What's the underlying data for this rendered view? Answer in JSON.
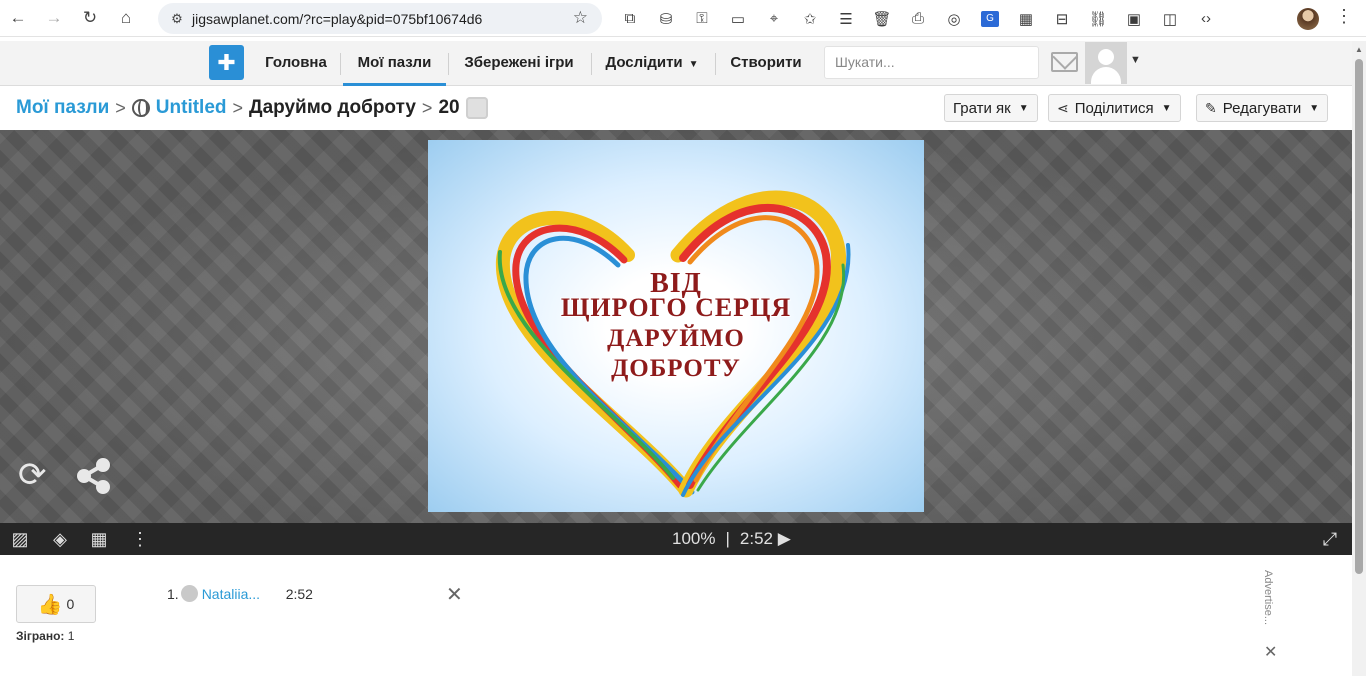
{
  "browser": {
    "url": "jigsawplanet.com/?rc=play&pid=075bf10674d6",
    "translate_label": "G"
  },
  "header": {
    "nav": [
      "Головна",
      "Мої пазли",
      "Збережені ігри",
      "Дослідити",
      "Створити"
    ],
    "search_placeholder": "Шукати..."
  },
  "breadcrumb": {
    "my_puzzles": "Мої пазли",
    "folder": "Untitled",
    "puzzle_title": "Даруймо доброту",
    "piece_count": "20"
  },
  "actions": {
    "play_as": "Грати як",
    "share": "Поділитися",
    "edit": "Редагувати"
  },
  "image_text": {
    "line1": "ВІД",
    "line2": "ЩИРОГО СЕРЦЯ",
    "line3": "ДАРУЙМО",
    "line4": "ДОБРОТУ"
  },
  "controls": {
    "progress": "100%",
    "divider": "|",
    "timer": "2:52"
  },
  "stats": {
    "likes": "0",
    "played_label": "Зіграно:",
    "played_count": "1"
  },
  "scores": [
    {
      "rank": "1.",
      "name": "Nataliia...",
      "time": "2:52"
    }
  ],
  "advert_label": "Advertise...",
  "colors": {
    "accent": "#2a9ad6",
    "text_red": "#8e1b1b"
  }
}
